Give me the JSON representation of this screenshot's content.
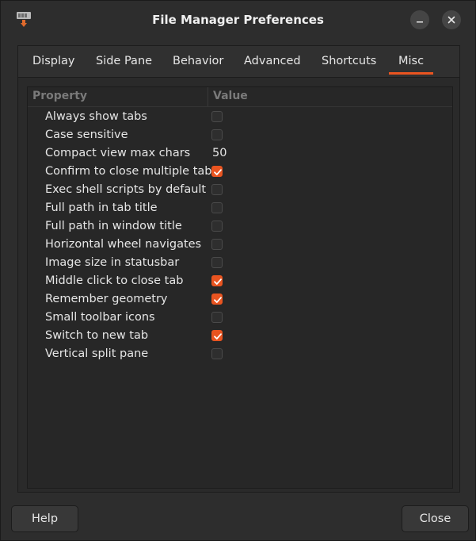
{
  "window": {
    "title": "File Manager Preferences",
    "accent": "#e95420"
  },
  "tabs": [
    {
      "label": "Display",
      "active": false
    },
    {
      "label": "Side Pane",
      "active": false
    },
    {
      "label": "Behavior",
      "active": false
    },
    {
      "label": "Advanced",
      "active": false
    },
    {
      "label": "Shortcuts",
      "active": false
    },
    {
      "label": "Misc",
      "active": true
    }
  ],
  "table": {
    "headers": {
      "property": "Property",
      "value": "Value"
    },
    "rows": [
      {
        "label": "Always show tabs",
        "type": "checkbox",
        "checked": false
      },
      {
        "label": "Case sensitive",
        "type": "checkbox",
        "checked": false
      },
      {
        "label": "Compact view max chars",
        "type": "text",
        "value": "50"
      },
      {
        "label": "Confirm to close multiple tabs",
        "type": "checkbox",
        "checked": true
      },
      {
        "label": "Exec shell scripts by default",
        "type": "checkbox",
        "checked": false
      },
      {
        "label": "Full path in tab title",
        "type": "checkbox",
        "checked": false
      },
      {
        "label": "Full path in window title",
        "type": "checkbox",
        "checked": false
      },
      {
        "label": "Horizontal wheel navigates",
        "type": "checkbox",
        "checked": false
      },
      {
        "label": "Image size in statusbar",
        "type": "checkbox",
        "checked": false
      },
      {
        "label": "Middle click to close tab",
        "type": "checkbox",
        "checked": true
      },
      {
        "label": "Remember geometry",
        "type": "checkbox",
        "checked": true
      },
      {
        "label": "Small toolbar icons",
        "type": "checkbox",
        "checked": false
      },
      {
        "label": "Switch to new tab",
        "type": "checkbox",
        "checked": true
      },
      {
        "label": "Vertical split pane",
        "type": "checkbox",
        "checked": false
      }
    ]
  },
  "buttons": {
    "help": "Help",
    "close": "Close"
  },
  "icons": {
    "app": "app-icon",
    "minimize": "minimize-icon",
    "close": "close-icon",
    "check": "check-icon"
  }
}
